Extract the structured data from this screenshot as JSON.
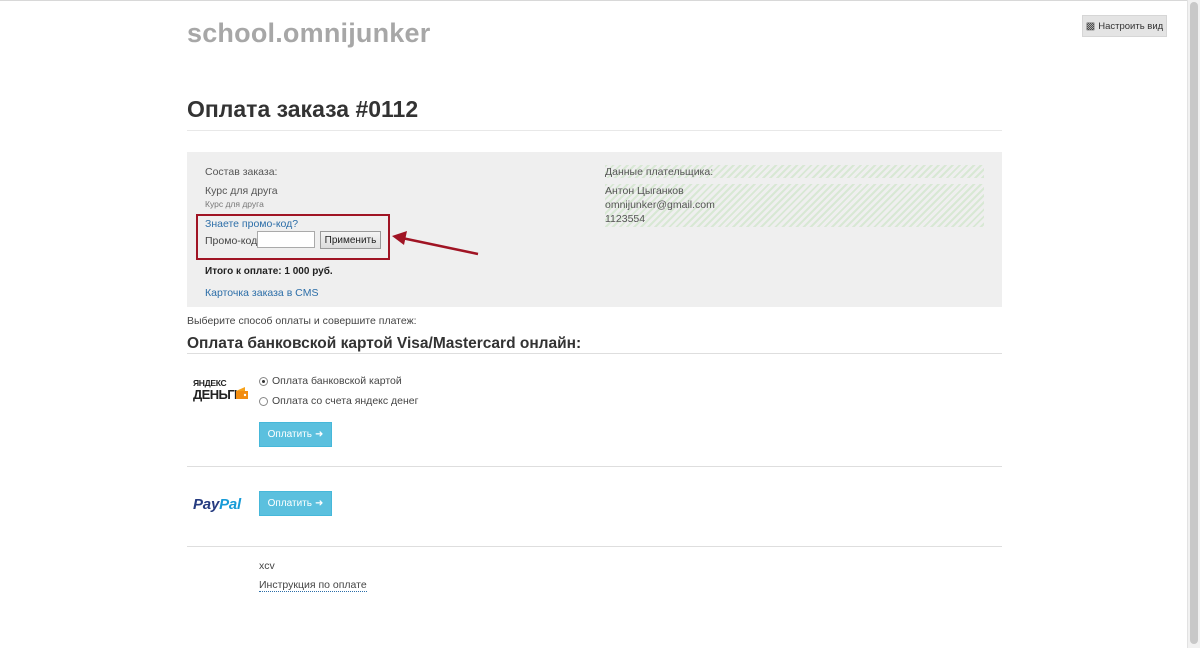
{
  "site": {
    "title": "school.omnijunker"
  },
  "toolbar": {
    "setup_view_label": "Настроить вид",
    "setup_icon": "puzzle-icon"
  },
  "page": {
    "heading": "Оплата заказа #0112"
  },
  "order": {
    "composition_label": "Состав заказа:",
    "item_title": "Курс для друга",
    "item_subtitle": "Курс для друга",
    "promo_link": "Знаете промо-код?",
    "promo_label": "Промо-код",
    "promo_value": "",
    "apply_label": "Применить",
    "total": "Итого к оплате: 1 000 руб.",
    "cms_link": "Карточка заказа в CMS"
  },
  "payer": {
    "label": "Данные плательщика:",
    "name": "Антон Цыганков",
    "email": "omnijunker@gmail.com",
    "phone": "1123554"
  },
  "payment": {
    "instruction": "Выберите способ оплаты и совершите платеж:",
    "section_heading": "Оплата банковской картой Visa/Mastercard онлайн:",
    "yandex": {
      "logo_line1": "ЯНДЕКС",
      "logo_line2": "ДЕНЬГИ",
      "options": [
        {
          "label": "Оплата банковской картой",
          "checked": true
        },
        {
          "label": "Оплата со счета яндекс денег",
          "checked": false
        }
      ],
      "pay_label": "Оплатить"
    },
    "paypal": {
      "logo_part1": "Pay",
      "logo_part2": "Pal",
      "pay_label": "Оплатить"
    },
    "note": "xcv",
    "instruction_link": "Инструкция по оплате"
  },
  "colors": {
    "accent": "#5bc0de",
    "link": "#2c6ea8",
    "highlight": "#a01424"
  }
}
